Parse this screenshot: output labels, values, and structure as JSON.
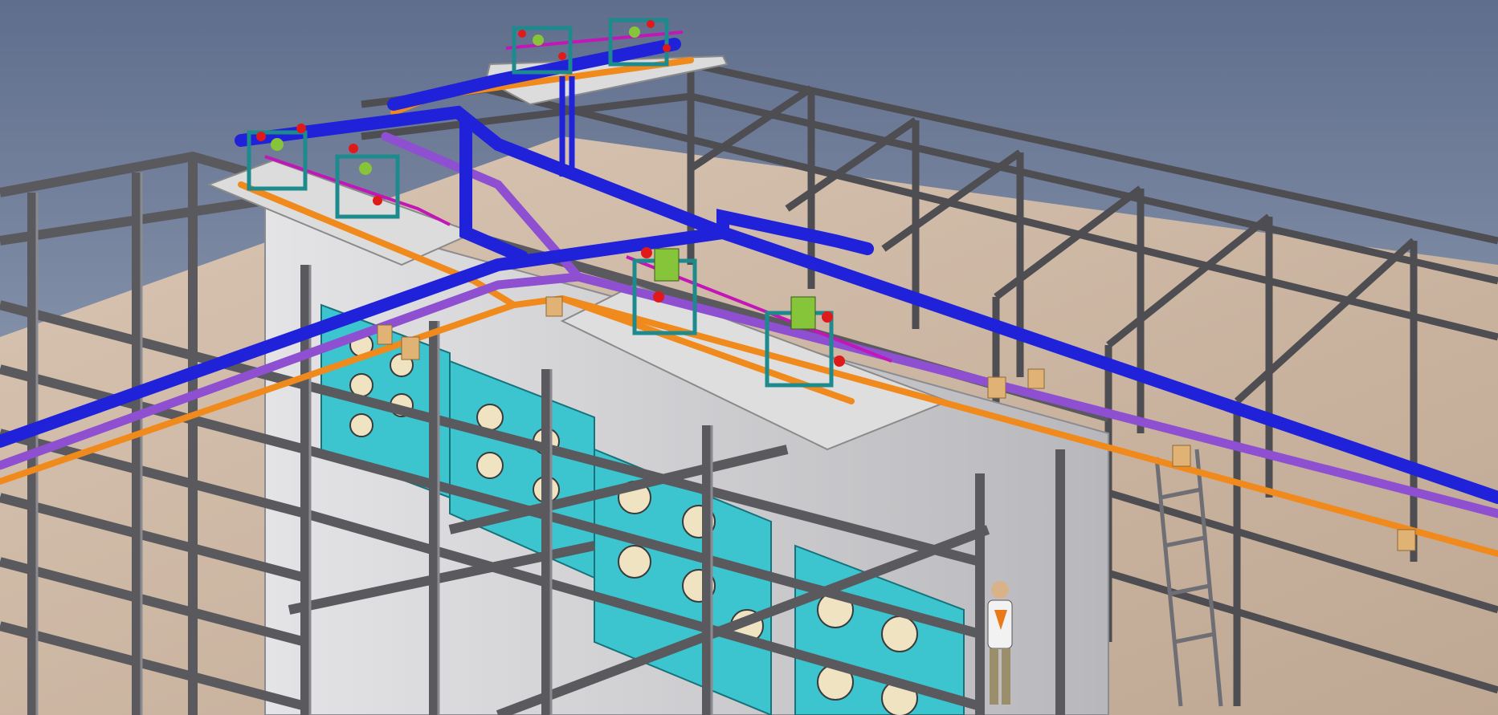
{
  "scene": {
    "colors": {
      "background_top": "#6b7a96",
      "background_bottom": "#a9b3c6",
      "floor": "#c9b39f",
      "steel": "#5a5a5e",
      "steel_dark": "#3c3c40",
      "panel": "#cfcfd1",
      "platform": "#dcdcdc",
      "pipe_blue": "#1f22d8",
      "pipe_violet": "#8e4fd0",
      "pipe_orange": "#f08a1c",
      "pipe_magenta": "#c316b8",
      "skid_frame": "#1d8a8e",
      "fan_panel": "#3cc4cf",
      "valve_red": "#e01a1a",
      "valve_green": "#86c43a",
      "bracket": "#e0b274"
    }
  }
}
